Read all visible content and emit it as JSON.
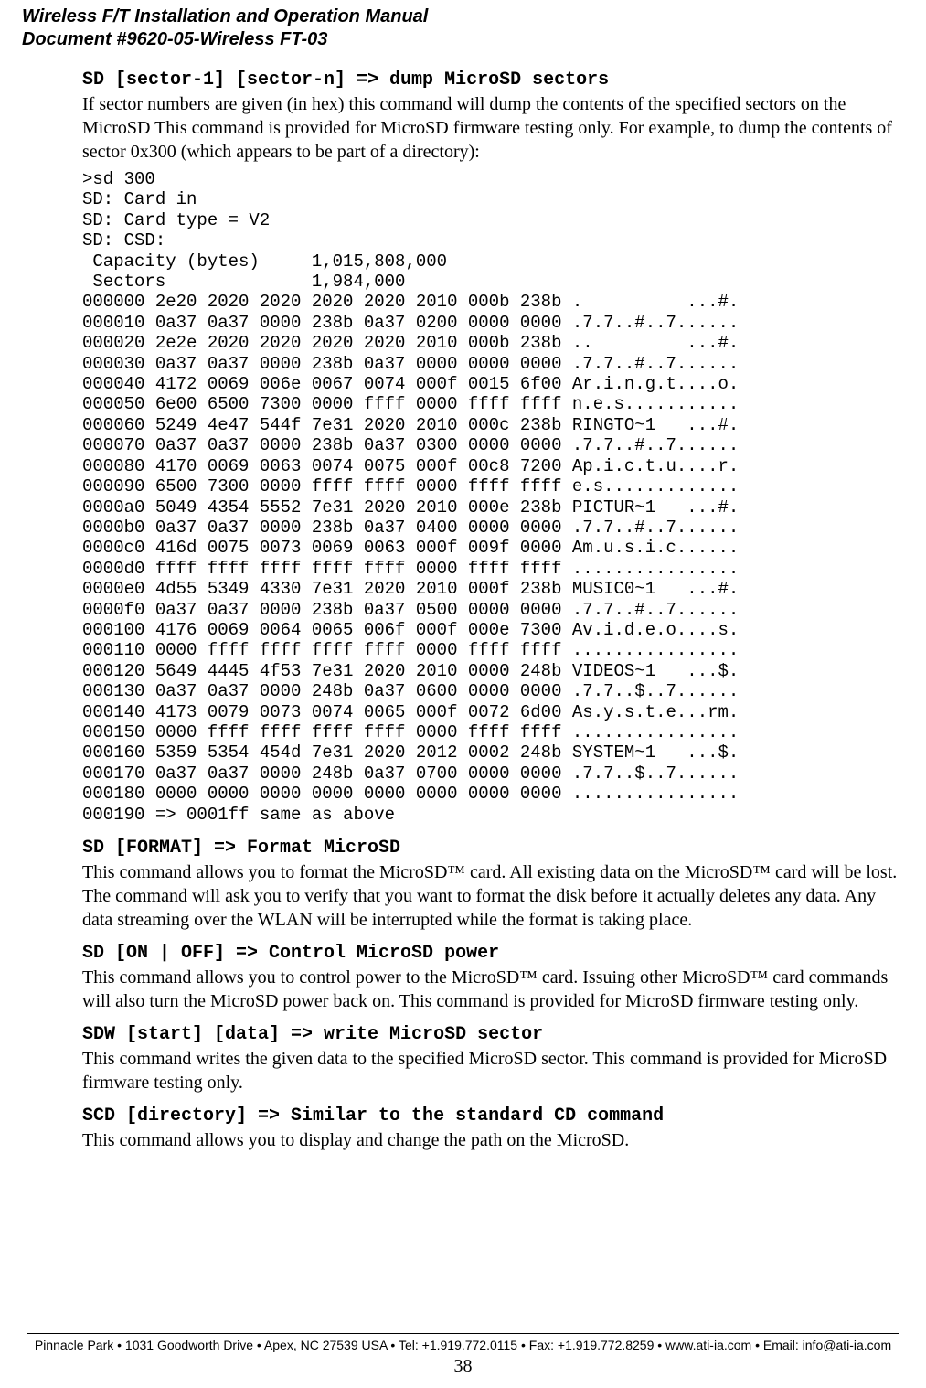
{
  "header": {
    "title_line1": "Wireless F/T Installation and Operation Manual",
    "title_line2": "Document #9620-05-Wireless FT-03"
  },
  "sections": {
    "sd_dump": {
      "heading": "SD [sector-1] [sector-n] => dump MicroSD sectors",
      "para": "If sector numbers are given (in hex) this command will dump the contents of the specified sectors on the MicroSD This command is provided for MicroSD firmware testing only. For example, to dump the contents of sector 0x300 (which appears to be part of a directory):",
      "dump": ">sd 300\nSD: Card in\nSD: Card type = V2\nSD: CSD:\n Capacity (bytes)     1,015,808,000\n Sectors              1,984,000\n000000 2e20 2020 2020 2020 2020 2010 000b 238b .          ...#.\n000010 0a37 0a37 0000 238b 0a37 0200 0000 0000 .7.7..#..7......\n000020 2e2e 2020 2020 2020 2020 2010 000b 238b ..         ...#.\n000030 0a37 0a37 0000 238b 0a37 0000 0000 0000 .7.7..#..7......\n000040 4172 0069 006e 0067 0074 000f 0015 6f00 Ar.i.n.g.t....o.\n000050 6e00 6500 7300 0000 ffff 0000 ffff ffff n.e.s...........\n000060 5249 4e47 544f 7e31 2020 2010 000c 238b RINGTO~1   ...#.\n000070 0a37 0a37 0000 238b 0a37 0300 0000 0000 .7.7..#..7......\n000080 4170 0069 0063 0074 0075 000f 00c8 7200 Ap.i.c.t.u....r.\n000090 6500 7300 0000 ffff ffff 0000 ffff ffff e.s.............\n0000a0 5049 4354 5552 7e31 2020 2010 000e 238b PICTUR~1   ...#.\n0000b0 0a37 0a37 0000 238b 0a37 0400 0000 0000 .7.7..#..7......\n0000c0 416d 0075 0073 0069 0063 000f 009f 0000 Am.u.s.i.c......\n0000d0 ffff ffff ffff ffff ffff 0000 ffff ffff ................\n0000e0 4d55 5349 4330 7e31 2020 2010 000f 238b MUSIC0~1   ...#.\n0000f0 0a37 0a37 0000 238b 0a37 0500 0000 0000 .7.7..#..7......\n000100 4176 0069 0064 0065 006f 000f 000e 7300 Av.i.d.e.o....s.\n000110 0000 ffff ffff ffff ffff 0000 ffff ffff ................\n000120 5649 4445 4f53 7e31 2020 2010 0000 248b VIDEOS~1   ...$.\n000130 0a37 0a37 0000 248b 0a37 0600 0000 0000 .7.7..$..7......\n000140 4173 0079 0073 0074 0065 000f 0072 6d00 As.y.s.t.e...rm.\n000150 0000 ffff ffff ffff ffff 0000 ffff ffff ................\n000160 5359 5354 454d 7e31 2020 2012 0002 248b SYSTEM~1   ...$.\n000170 0a37 0a37 0000 248b 0a37 0700 0000 0000 .7.7..$..7......\n000180 0000 0000 0000 0000 0000 0000 0000 0000 ................\n000190 => 0001ff same as above"
    },
    "sd_format": {
      "heading": "SD [FORMAT] => Format MicroSD",
      "para": "This command allows you to format the MicroSD™ card. All existing data on the MicroSD™ card will be lost. The command will ask you to verify that you want to format the disk before it actually deletes any data. Any data streaming over the WLAN will be interrupted while the format is taking place."
    },
    "sd_power": {
      "heading": "SD [ON | OFF] => Control MicroSD power",
      "para": "This command allows you to control power to the MicroSD™ card. Issuing other MicroSD™ card commands will also turn the MicroSD power back on. This command is provided for MicroSD firmware testing only."
    },
    "sdw": {
      "heading": "SDW [start] [data] => write MicroSD sector",
      "para": "This command writes the given data to the specified MicroSD sector. This command is provided for MicroSD firmware testing only."
    },
    "scd": {
      "heading": "SCD [directory] => Similar to the standard CD command",
      "para": "This command allows you to display and change the path on the MicroSD."
    }
  },
  "footer": {
    "contact": "Pinnacle Park • 1031 Goodworth Drive • Apex, NC 27539 USA • Tel: +1.919.772.0115 • Fax: +1.919.772.8259 • www.ati-ia.com • Email: info@ati-ia.com",
    "pageno": "38"
  }
}
